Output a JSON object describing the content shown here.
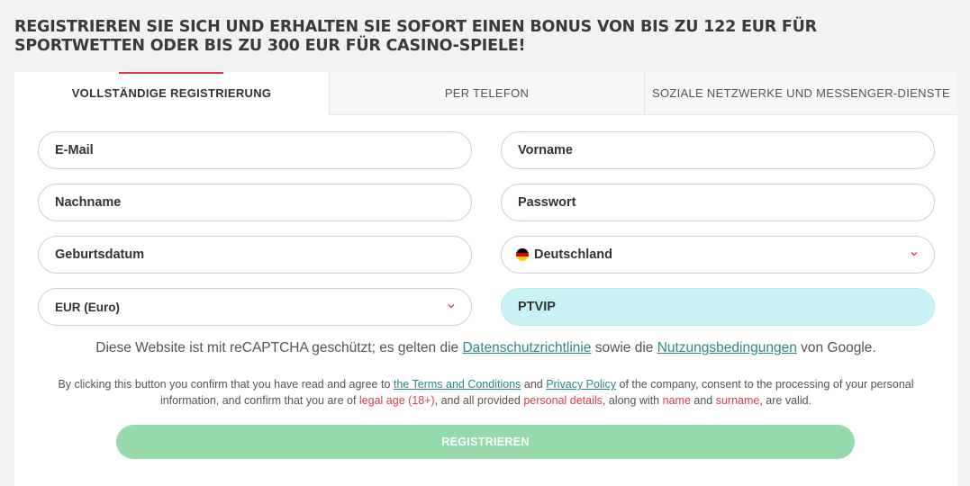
{
  "headline": "REGISTRIEREN SIE SICH UND ERHALTEN SIE SOFORT EINEN BONUS VON BIS ZU 122 EUR FÜR SPORTWETTEN ODER BIS ZU 300 EUR FÜR CASINO-SPIELE!",
  "tabs": [
    {
      "label": "VOLLSTÄNDIGE REGISTRIERUNG",
      "active": true
    },
    {
      "label": "PER TELEFON",
      "active": false
    },
    {
      "label": "SOZIALE NETZWERKE UND MESSENGER-DIENSTE",
      "active": false
    }
  ],
  "fields": {
    "email": "E-Mail",
    "first_name": "Vorname",
    "last_name": "Nachname",
    "password": "Passwort",
    "birthdate": "Geburtsdatum",
    "country": "Deutschland",
    "currency": "EUR (Euro)",
    "promo_code": "PTVIP"
  },
  "captcha": {
    "prefix": "Diese Website ist mit reCAPTCHA geschützt; es gelten die ",
    "privacy_link": "Datenschutzrichtlinie",
    "middle": " sowie die ",
    "terms_link": "Nutzungsbedingungen",
    "suffix": " von Google."
  },
  "legal": {
    "t1": "By clicking this button you confirm that you have read and agree to ",
    "terms_link": "the Terms and Conditions",
    "t2": " and ",
    "privacy_link": "Privacy Policy",
    "t3": " of the company, consent to the processing of your personal information, and confirm that you are of ",
    "legal_age": "legal age (18+)",
    "t4": ", and all provided ",
    "personal_details": "personal details",
    "t5": ", along with ",
    "name": "name",
    "t6": " and ",
    "surname": "surname",
    "t7": ", are valid."
  },
  "submit_label": "REGISTRIEREN",
  "colors": {
    "accent_red": "#e0394a",
    "submit_green": "#95dbab",
    "promo_bg": "#c8f3f7",
    "link_teal": "#2a8a8a"
  }
}
